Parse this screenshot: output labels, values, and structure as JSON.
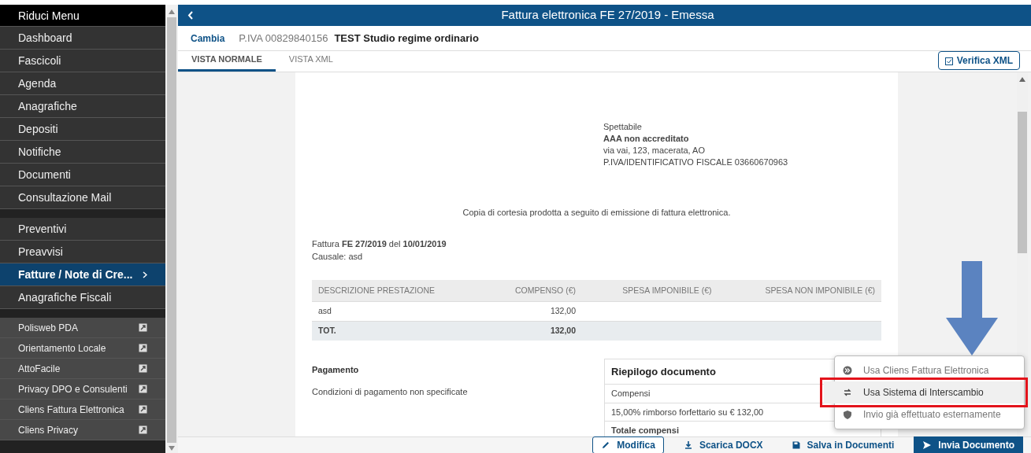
{
  "sidebar": {
    "collapse_label": "Riduci Menu",
    "groups": [
      {
        "kind": "main",
        "items": [
          {
            "label": "Dashboard",
            "selected": false
          },
          {
            "label": "Fascicoli",
            "selected": false
          },
          {
            "label": "Agenda",
            "selected": false
          },
          {
            "label": "Anagrafiche",
            "selected": false
          },
          {
            "label": "Depositi",
            "selected": false
          },
          {
            "label": "Notifiche",
            "selected": false
          },
          {
            "label": "Documenti",
            "selected": false
          },
          {
            "label": "Consultazione Mail",
            "selected": false
          }
        ]
      },
      {
        "kind": "main",
        "items": [
          {
            "label": "Preventivi",
            "selected": false
          },
          {
            "label": "Preavvisi",
            "selected": false
          },
          {
            "label": "Fatture / Note di Cre...",
            "selected": true
          },
          {
            "label": "Anagrafiche Fiscali",
            "selected": false
          }
        ]
      },
      {
        "kind": "external",
        "items": [
          {
            "label": "Polisweb PDA",
            "selected": false
          },
          {
            "label": "Orientamento Locale",
            "selected": false
          },
          {
            "label": "AttoFacile",
            "selected": false
          },
          {
            "label": "Privacy DPO e Consulenti",
            "selected": false
          },
          {
            "label": "Cliens Fattura Elettronica",
            "selected": false
          },
          {
            "label": "Cliens Privacy",
            "selected": false
          }
        ]
      }
    ]
  },
  "header": {
    "title": "Fattura elettronica FE 27/2019 - Emessa"
  },
  "subheader": {
    "change_link": "Cambia",
    "vat": "P.IVA 00829840156",
    "name": "TEST Studio regime ordinario"
  },
  "tabs": [
    {
      "label": "VISTA NORMALE",
      "selected": true
    },
    {
      "label": "VISTA XML",
      "selected": false
    }
  ],
  "verify_button": "Verifica XML",
  "document": {
    "recipient": {
      "salutation": "Spettabile",
      "name": "AAA non accreditato",
      "address": "via vai, 123, macerata, AO",
      "tax_id": "P.IVA/IDENTIFICATIVO FISCALE 03660670963"
    },
    "courtesy_note": "Copia di cortesia prodotta a seguito di emissione di fattura elettronica.",
    "invoice_line": "Fattura **FE 27/2019** del **10/01/2019**",
    "cause": "Causale: asd",
    "table": {
      "columns": [
        "DESCRIZIONE PRESTAZIONE",
        "COMPENSO (€)",
        "SPESA IMPONIBILE (€)",
        "SPESA NON IMPONIBILE (€)"
      ],
      "rows": [
        {
          "kind": "item",
          "cells": [
            "asd",
            "132,00",
            "",
            ""
          ]
        },
        {
          "kind": "total",
          "cells": [
            "TOT.",
            "132,00",
            "",
            ""
          ]
        }
      ]
    },
    "payment": {
      "title": "Pagamento",
      "text": "Condizioni di pagamento non specificate"
    },
    "summary": {
      "title": "Riepilogo documento",
      "rows": [
        {
          "label": "Compensi",
          "kind": "item"
        },
        {
          "label": "15,00% rimborso forfettario su € 132,00",
          "kind": "item"
        },
        {
          "label": "Totale compensi",
          "kind": "total"
        }
      ]
    }
  },
  "send_menu": [
    {
      "label": "Usa Cliens Fattura Elettronica",
      "selected": false
    },
    {
      "label": "Usa Sistema di Interscambio",
      "selected": true
    },
    {
      "label": "Invio già effettuato esternamente",
      "selected": false
    }
  ],
  "footer_buttons": [
    {
      "label": "Modifica",
      "kind": "outline"
    },
    {
      "label": "Scarica DOCX",
      "kind": "link"
    },
    {
      "label": "Salva in Documenti",
      "kind": "link"
    },
    {
      "label": "Invia Documento",
      "kind": "primary"
    }
  ]
}
